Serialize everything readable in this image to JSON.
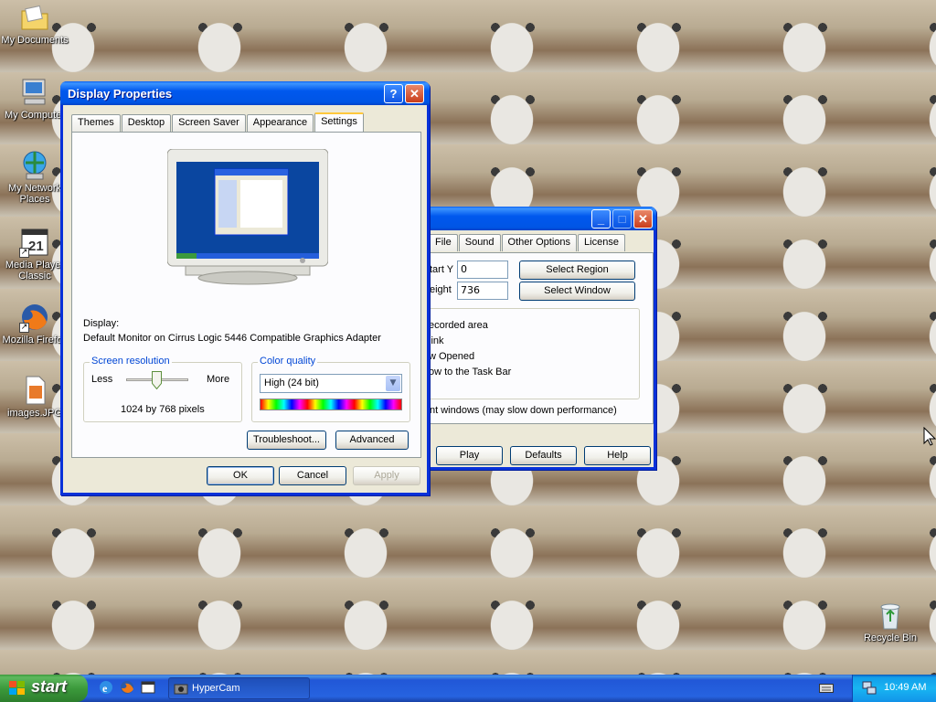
{
  "desktop_icons": [
    {
      "label": "My Documents",
      "icon": "folder-documents-icon"
    },
    {
      "label": "My Computer",
      "icon": "computer-icon"
    },
    {
      "label": "My Network Places",
      "icon": "network-places-icon"
    },
    {
      "label": "Media Player Classic",
      "icon": "media-player-icon"
    },
    {
      "label": "Mozilla Firefox",
      "icon": "firefox-icon"
    },
    {
      "label": "images.JPG",
      "icon": "image-file-icon"
    },
    {
      "label": "Recycle Bin",
      "icon": "recycle-bin-icon"
    }
  ],
  "display_properties": {
    "title": "Display Properties",
    "help_btn": "?",
    "close_btn": "✕",
    "tabs": [
      "Themes",
      "Desktop",
      "Screen Saver",
      "Appearance",
      "Settings"
    ],
    "active_tab": "Settings",
    "display_label": "Display:",
    "display_value": "Default Monitor on Cirrus Logic 5446 Compatible Graphics Adapter",
    "screen_resolution": {
      "legend": "Screen resolution",
      "less": "Less",
      "more": "More",
      "value_text": "1024 by 768 pixels"
    },
    "color_quality": {
      "legend": "Color quality",
      "selected": "High (24 bit)"
    },
    "buttons": {
      "troubleshoot": "Troubleshoot...",
      "advanced": "Advanced",
      "ok": "OK",
      "cancel": "Cancel",
      "apply": "Apply"
    }
  },
  "hypercam": {
    "tabs": [
      "File",
      "Sound",
      "Other Options",
      "License"
    ],
    "start_y_label": "tart Y",
    "start_y_value": "0",
    "height_label": "eight",
    "height_value": "736",
    "select_region": "Select Region",
    "select_window": "Select Window",
    "option_lines": [
      "ecorded area",
      "link",
      "w Opened",
      "ow to the Task Bar"
    ],
    "transparent_windows": "nt windows (may slow down performance)",
    "buttons": {
      "play": "Play",
      "defaults": "Defaults",
      "help": "Help"
    },
    "min_btn": "_",
    "max_btn": "□",
    "close_btn": "✕"
  },
  "taskbar": {
    "start_label": "start",
    "quick_launch": [
      "ie-icon",
      "firefox-icon",
      "media-player-icon"
    ],
    "task_label": "HyperCam",
    "clock": "10:49 AM"
  }
}
